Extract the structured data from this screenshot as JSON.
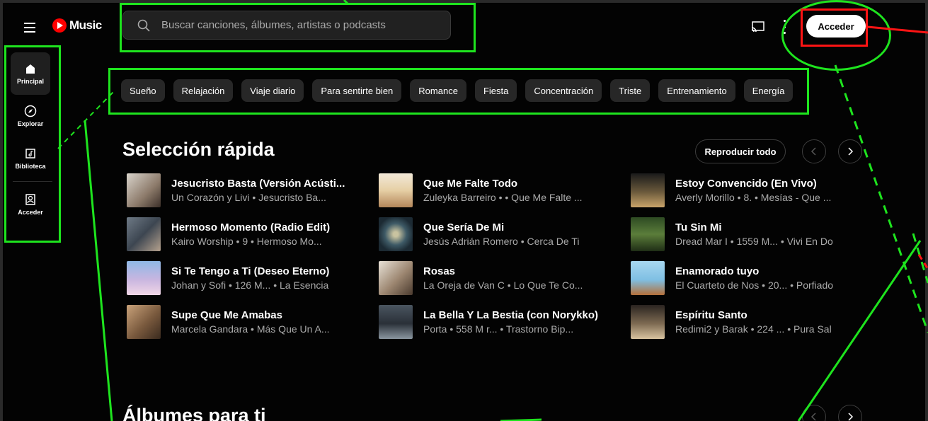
{
  "app": {
    "logo_text": "Music",
    "brand_color": "#ff0000"
  },
  "search": {
    "placeholder": "Buscar canciones, álbumes, artistas o podcasts"
  },
  "header": {
    "signin_label": "Acceder"
  },
  "sidebar": {
    "items": [
      {
        "label": "Principal",
        "icon": "home-icon"
      },
      {
        "label": "Explorar",
        "icon": "compass-icon"
      },
      {
        "label": "Biblioteca",
        "icon": "library-icon"
      },
      {
        "label": "Acceder",
        "icon": "account-icon"
      }
    ]
  },
  "chips": [
    "Sueño",
    "Relajación",
    "Viaje diario",
    "Para sentirte bien",
    "Romance",
    "Fiesta",
    "Concentración",
    "Triste",
    "Entrenamiento",
    "Energía"
  ],
  "quick_picks": {
    "title": "Selección rápida",
    "play_all_label": "Reproducir todo",
    "songs": [
      {
        "title": "Jesucristo Basta (Versión Acústi...",
        "subtitle": "Un Corazón y Livi • Jesucristo Ba..."
      },
      {
        "title": "Hermoso Momento (Radio Edit)",
        "subtitle": "Kairo Worship • 9 • Hermoso Mo..."
      },
      {
        "title": "Si Te Tengo a Ti (Deseo Eterno)",
        "subtitle": "Johan y Sofi • 126 M... • La Esencia"
      },
      {
        "title": "Supe Que Me Amabas",
        "subtitle": "Marcela Gandara • Más Que Un A..."
      },
      {
        "title": "Que Me Falte Todo",
        "subtitle": "Zuleyka Barreiro • • Que Me Falte ..."
      },
      {
        "title": "Que Sería De Mi",
        "subtitle": "Jesús Adrián Romero • Cerca De Ti"
      },
      {
        "title": "Rosas",
        "subtitle": "La Oreja de Van C • Lo Que Te Co..."
      },
      {
        "title": "La Bella Y La Bestia (con Norykko)",
        "subtitle": "Porta • 558 M r... • Trastorno Bip..."
      },
      {
        "title": "Estoy Convencido (En Vivo)",
        "subtitle": "Averly Morillo • 8. • Mesías - Que ..."
      },
      {
        "title": "Tu Sin Mi",
        "subtitle": "Dread Mar I • 1559 M... • Vivi En Do"
      },
      {
        "title": "Enamorado tuyo",
        "subtitle": "El Cuarteto de Nos • 20... • Porfiado"
      },
      {
        "title": "Espíritu Santo",
        "subtitle": "Redimi2 y Barak • 224 ... • Pura Sal"
      }
    ]
  },
  "albums": {
    "title": "Álbumes para ti"
  },
  "annotation_colors": {
    "box": "#1ee41e",
    "highlight": "#ff1414"
  }
}
